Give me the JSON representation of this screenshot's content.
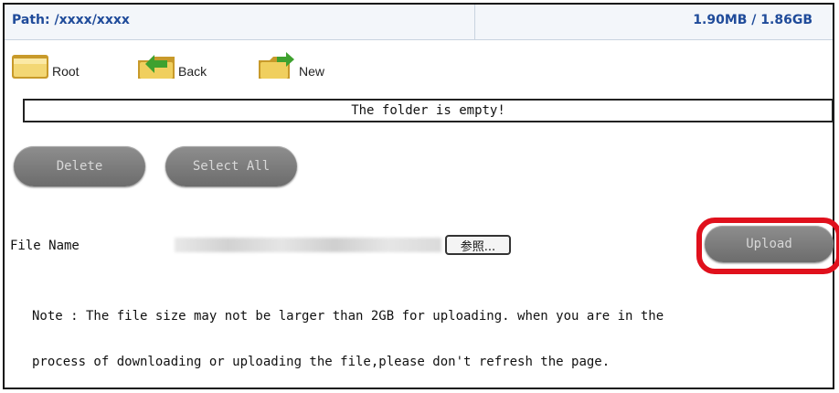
{
  "header": {
    "path_label": "Path: /xxxx/xxxx",
    "usage": "1.90MB / 1.86GB"
  },
  "toolbar": {
    "root_label": "Root",
    "back_label": "Back",
    "new_label": "New"
  },
  "file_list": {
    "empty_message": "The folder is empty!"
  },
  "actions": {
    "delete_label": "Delete",
    "select_all_label": "Select All"
  },
  "upload": {
    "file_name_label": "File Name",
    "browse_label": "参照...",
    "upload_label": "Upload",
    "highlight_color": "#e0101c"
  },
  "note": {
    "line1": "Note : The file size may not be larger than 2GB for uploading. when you are in the",
    "line2": "process of downloading or uploading the file,please don't refresh the page."
  },
  "colors": {
    "header_text": "#1f4b9a",
    "button_gray": "#7a7a7a",
    "folder_yellow": "#e9c94a"
  }
}
